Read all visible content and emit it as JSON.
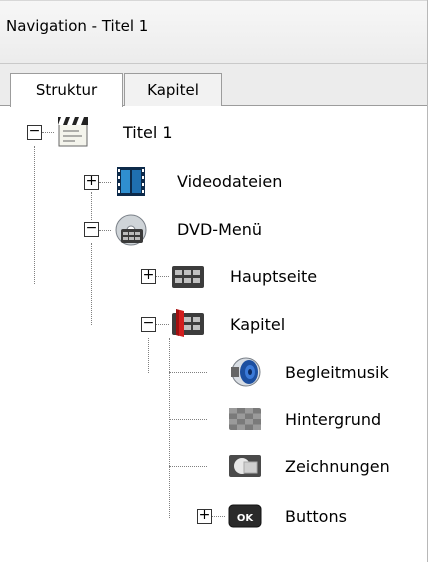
{
  "panel": {
    "title": "Navigation - Titel 1"
  },
  "tabs": [
    {
      "label": "Struktur",
      "active": true
    },
    {
      "label": "Kapitel",
      "active": false
    }
  ],
  "tree": {
    "root": {
      "label": "Titel 1",
      "icon": "clapperboard-icon",
      "expanded": true
    },
    "videodateien": {
      "label": "Videodateien",
      "icon": "film-strip-icon",
      "expanded": false
    },
    "dvd_menu": {
      "label": "DVD-Menü",
      "icon": "dvd-disc-icon",
      "expanded": true
    },
    "hauptseite": {
      "label": "Hauptseite",
      "icon": "menu-page-icon",
      "expanded": false
    },
    "kapitel": {
      "label": "Kapitel",
      "icon": "chapter-page-icon",
      "expanded": true
    },
    "begleitmusik": {
      "label": "Begleitmusik",
      "icon": "speaker-icon"
    },
    "hintergrund": {
      "label": "Hintergrund",
      "icon": "checkerboard-icon"
    },
    "zeichnungen": {
      "label": "Zeichnungen",
      "icon": "drawing-icon"
    },
    "buttons": {
      "label": "Buttons",
      "icon": "ok-button-icon",
      "ok_text": "OK",
      "expanded": false
    }
  },
  "toggle_symbols": {
    "expanded": "−",
    "collapsed": "+"
  }
}
